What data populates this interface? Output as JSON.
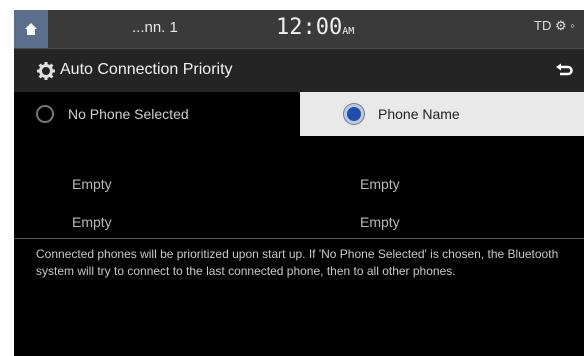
{
  "status_bar": {
    "signal_text": "...nn. 1",
    "time": "12:00",
    "time_suffix": "AM",
    "right_icons": "TD ⚙ ◦"
  },
  "title_bar": {
    "title": "Auto Connection Priority"
  },
  "options": {
    "no_phone_label": "No Phone Selected",
    "phone_name_label": "Phone Name",
    "selected": "Phone Name"
  },
  "slots": {
    "left": [
      "Empty",
      "Empty"
    ],
    "right": [
      "Empty",
      "Empty"
    ]
  },
  "description": "Connected phones will be prioritized upon start up. If 'No Phone Selected' is chosen, the Bluetooth system will try to connect to the last connected phone, then to all other phones.",
  "colors": {
    "status_bg": "#3a3a3a",
    "home_button": "#5b6e8c",
    "selected_option_bg": "#e9e9e9",
    "radio_selected": "#1d4fb0"
  }
}
